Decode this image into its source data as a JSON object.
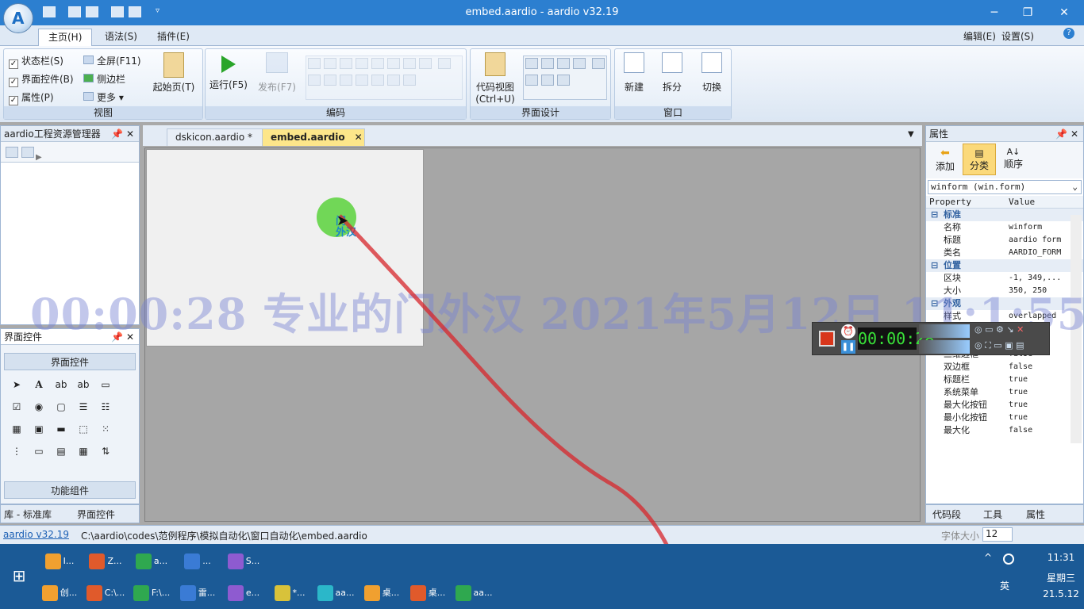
{
  "window": {
    "title": "embed.aardio - aardio v32.19",
    "app_icon": "aardio-logo",
    "controls": [
      "minimize",
      "restore",
      "close"
    ]
  },
  "ribbon": {
    "tabs": [
      {
        "label": "主页(H)"
      },
      {
        "label": "语法(S)"
      },
      {
        "label": "插件(E)"
      }
    ],
    "right_menus": {
      "edit": "编辑(E)",
      "settings": "设置(S)",
      "help": "?"
    },
    "view": {
      "statusbar": "状态栏(S)",
      "ui_controls": "界面控件(B)",
      "properties": "属性(P)",
      "fullscreen": "全屏(F11)",
      "sidebar": "侧边栏",
      "more": "更多",
      "start_page": "起始页(T)",
      "caption": "视图"
    },
    "code": {
      "run": "运行(F5)",
      "publish": "发布(F7)",
      "caption": "编码"
    },
    "design": {
      "code_view": "代码视图",
      "code_view_key": "(Ctrl+U)",
      "caption": "界面设计"
    },
    "window_group": {
      "new": "新建",
      "split": "拆分",
      "switch": "切换",
      "caption": "窗口"
    }
  },
  "left_panel": {
    "project_title": "aardio工程资源管理器",
    "controls_title": "界面控件",
    "controls_section": "界面控件",
    "functions_section": "功能组件",
    "tabs": [
      "库 - 标准库",
      "界面控件"
    ]
  },
  "doc_tabs": [
    {
      "label": "dskicon.aardio *"
    },
    {
      "label": "embed.aardio"
    }
  ],
  "form": {
    "label_lines": [
      "门",
      "外汉"
    ]
  },
  "properties": {
    "title": "属性",
    "buttons": {
      "add": "添加",
      "category": "分类",
      "order": "顺序"
    },
    "object": "winform (win.form)",
    "headers": {
      "property": "Property",
      "value": "Value"
    },
    "rows": [
      {
        "type": "cat",
        "name": "标准"
      },
      {
        "name": "名称",
        "value": "winform"
      },
      {
        "name": "标题",
        "value": "aardio form"
      },
      {
        "name": "类名",
        "value": "AARDIO_FORM"
      },
      {
        "type": "cat",
        "name": "位置"
      },
      {
        "name": "区块",
        "value": "-1, 349,..."
      },
      {
        "name": "大小",
        "value": "350, 250"
      },
      {
        "type": "cat",
        "name": "外观"
      },
      {
        "name": "样式",
        "value": "overlapped"
      },
      {
        "name": "",
        "value": ""
      },
      {
        "name": "",
        "value": ""
      },
      {
        "name": "三维边框",
        "value": "false"
      },
      {
        "name": "双边框",
        "value": "false"
      },
      {
        "name": "标题栏",
        "value": "true"
      },
      {
        "name": "系统菜单",
        "value": "true"
      },
      {
        "name": "最大化按钮",
        "value": "true"
      },
      {
        "name": "最小化按钮",
        "value": "true"
      },
      {
        "name": "最大化",
        "value": "false"
      }
    ],
    "tabs": [
      "代码段",
      "工具",
      "属性"
    ]
  },
  "statusbar": {
    "version": "aardio v32.19",
    "path": "C:\\aardio\\codes\\范例程序\\模拟自动化\\窗口自动化\\embed.aardio",
    "font_label": "字体大小",
    "font_size": "12"
  },
  "overlay": {
    "watermark": "00:00:28  专业的门外汉  2021年5月12日 11:1:55",
    "recorder_time": "00:00:28"
  },
  "taskbar": {
    "row1": [
      {
        "label": "I..."
      },
      {
        "label": "Z..."
      },
      {
        "label": "a..."
      },
      {
        "label": "..."
      },
      {
        "label": "S..."
      }
    ],
    "row2": [
      {
        "label": "创..."
      },
      {
        "label": "C:\\..."
      },
      {
        "label": "F:\\..."
      },
      {
        "label": "雷..."
      },
      {
        "label": "e..."
      },
      {
        "label": "*..."
      },
      {
        "label": "aa..."
      },
      {
        "label": "桌..."
      },
      {
        "label": "桌..."
      },
      {
        "label": "aa..."
      }
    ],
    "time": "11:31",
    "ime": "英",
    "weekday": "星期三",
    "date": "21.5.12"
  }
}
